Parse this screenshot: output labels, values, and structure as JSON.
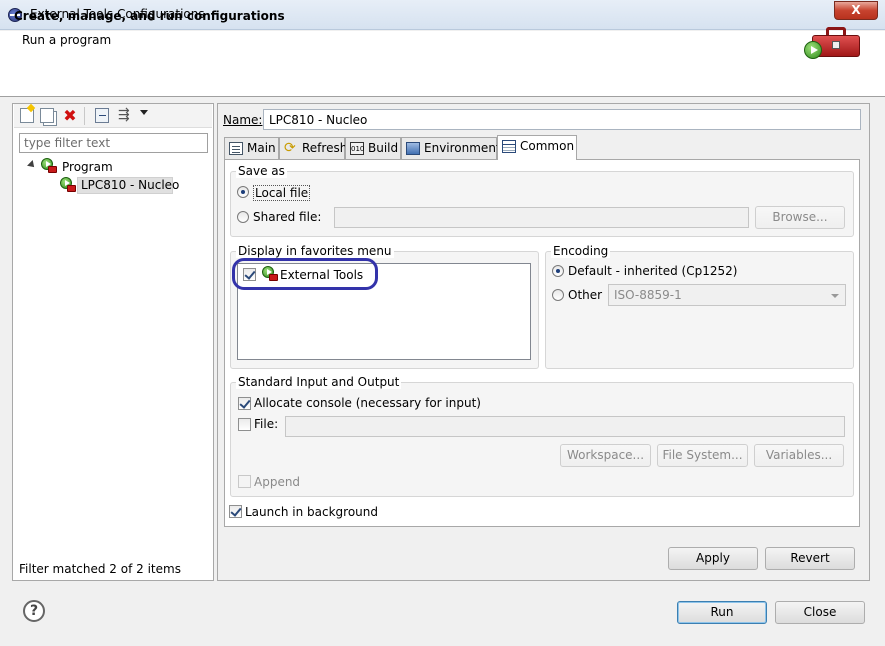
{
  "window": {
    "title": "External Tools Configurations",
    "close_label": "X"
  },
  "header": {
    "title": "Create, manage, and run configurations",
    "subtitle": "Run a program"
  },
  "left": {
    "filter_placeholder": "type filter text",
    "tree": {
      "group_label": "Program",
      "item_label": "LPC810 - Nucleo"
    },
    "status": "Filter matched 2 of 2 items"
  },
  "config": {
    "name_label": "Name:",
    "name_value": "LPC810 - Nucleo",
    "tabs": [
      {
        "label": "Main"
      },
      {
        "label": "Refresh"
      },
      {
        "label": "Build"
      },
      {
        "label": "Environment"
      },
      {
        "label": "Common"
      }
    ],
    "build_icon_text": "010"
  },
  "common": {
    "save_as": {
      "title": "Save as",
      "local_label": "Local file",
      "shared_label": "Shared file:",
      "browse_label": "Browse..."
    },
    "favorites": {
      "title": "Display in favorites menu",
      "item_label": "External Tools"
    },
    "encoding": {
      "title": "Encoding",
      "default_label": "Default - inherited (Cp1252)",
      "other_label": "Other",
      "other_value": "ISO-8859-1"
    },
    "stdio": {
      "title": "Standard Input and Output",
      "allocate_label": "Allocate console (necessary for input)",
      "file_label": "File:",
      "workspace_label": "Workspace...",
      "filesystem_label": "File System...",
      "variables_label": "Variables...",
      "append_label": "Append"
    },
    "launch_bg_label": "Launch in background"
  },
  "buttons": {
    "apply": "Apply",
    "revert": "Revert",
    "run": "Run",
    "close": "Close",
    "help": "?"
  }
}
